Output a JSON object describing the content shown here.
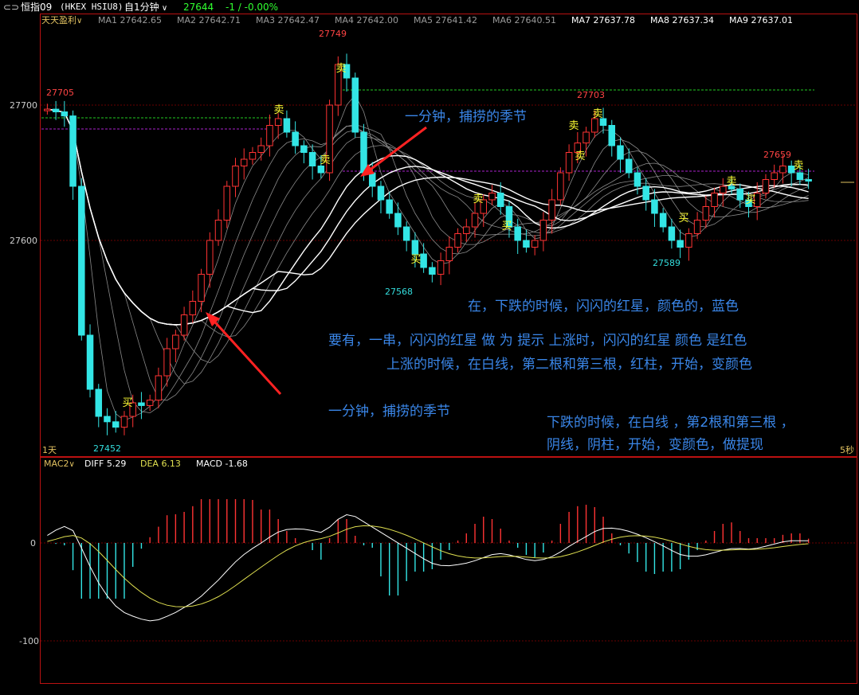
{
  "header": {
    "back_icon": "back-arrow-icon",
    "symbol_name": "恒指09",
    "symbol_code": "(HKEX HSIU8)",
    "period_label": "自1分钟",
    "last_price": "27644",
    "change": "-1 / -0.00%"
  },
  "ma_legend": {
    "indicator": "天天盈利",
    "items": [
      {
        "label": "MA1 27642.65",
        "color": "#9a9a9a"
      },
      {
        "label": "MA2 27642.71",
        "color": "#9a9a9a"
      },
      {
        "label": "MA3 27642.47",
        "color": "#9a9a9a"
      },
      {
        "label": "MA4 27642.00",
        "color": "#9a9a9a"
      },
      {
        "label": "MA5 27641.42",
        "color": "#9a9a9a"
      },
      {
        "label": "MA6 27640.51",
        "color": "#9a9a9a"
      },
      {
        "label": "MA7 27637.78",
        "color": "#ffffff"
      },
      {
        "label": "MA8 27637.34",
        "color": "#ffffff"
      },
      {
        "label": "MA9 27637.01",
        "color": "#ffffff"
      }
    ]
  },
  "price_panel": {
    "y_ticks": [
      "27700",
      "27600"
    ],
    "bottom_left_label": "1天",
    "bottom_right_label": "5秒",
    "price_marks": [
      {
        "text": "27705",
        "color": "#ff4444"
      },
      {
        "text": "27749",
        "color": "#ff4444"
      },
      {
        "text": "27703",
        "color": "#ff4444"
      },
      {
        "text": "27659",
        "color": "#ff4444"
      },
      {
        "text": "27452",
        "color": "#33dddd"
      },
      {
        "text": "27568",
        "color": "#33dddd"
      },
      {
        "text": "27589",
        "color": "#33dddd"
      }
    ],
    "signal_buy": "买",
    "signal_sell": "卖"
  },
  "macd_panel": {
    "name": "MAC2",
    "diff": "DIFF 5.29",
    "dea": "DEA 6.13",
    "macd": "MACD -1.68",
    "y_ticks": [
      "0",
      "-100"
    ]
  },
  "annotations": [
    "一分钟，捕捞的季节",
    "在，下跌的时候，闪闪的红星，颜色的，蓝色",
    "要有，一串，闪闪的红星 做 为 提示  上涨时，闪闪的红星 颜色 是红色",
    "上涨的时候，在白线，第二根和第三根，红柱，开始，变颜色",
    "一分钟，捕捞的季节",
    "下跌的时候，在白线 ，第2根和第三根 ，",
    "阴线，阴柱，开始，变颜色，做提现"
  ],
  "colors": {
    "up": "#ff3333",
    "down": "#33e5e5",
    "dea": "#e0e050",
    "diff": "#ffffff",
    "annotation": "#3a86e8",
    "arrow": "#ff2222",
    "frame": "#b01010"
  },
  "chart_data": {
    "type": "candlestick",
    "y_range_visible": [
      27452,
      27749
    ],
    "y_ticks": [
      27600,
      27700
    ],
    "key_prices": {
      "day_high_left": 27705,
      "high": 27749,
      "mid_high": 27703,
      "right_high": 27659,
      "low": 27452,
      "low2": 27568,
      "low3": 27589
    },
    "close_path": [
      27697,
      27695,
      27692,
      27640,
      27530,
      27490,
      27470,
      27466,
      27462,
      27470,
      27480,
      27478,
      27482,
      27500,
      27520,
      27530,
      27545,
      27555,
      27575,
      27600,
      27615,
      27640,
      27655,
      27660,
      27665,
      27670,
      27685,
      27690,
      27680,
      27670,
      27665,
      27655,
      27650,
      27700,
      27730,
      27720,
      27680,
      27650,
      27640,
      27630,
      27620,
      27610,
      27600,
      27590,
      27580,
      27575,
      27585,
      27595,
      27605,
      27610,
      27620,
      27630,
      27635,
      27625,
      27610,
      27600,
      27595,
      27600,
      27615,
      27630,
      27650,
      27665,
      27672,
      27680,
      27690,
      27685,
      27670,
      27660,
      27650,
      27640,
      27630,
      27620,
      27610,
      27600,
      27595,
      27605,
      27615,
      27625,
      27635,
      27640,
      27638,
      27630,
      27625,
      27635,
      27645,
      27650,
      27655,
      27650,
      27645,
      27644
    ],
    "macd": {
      "y_ticks": [
        0,
        -100
      ],
      "diff_last": 5.29,
      "dea_last": 6.13,
      "macd_last": -1.68
    }
  }
}
